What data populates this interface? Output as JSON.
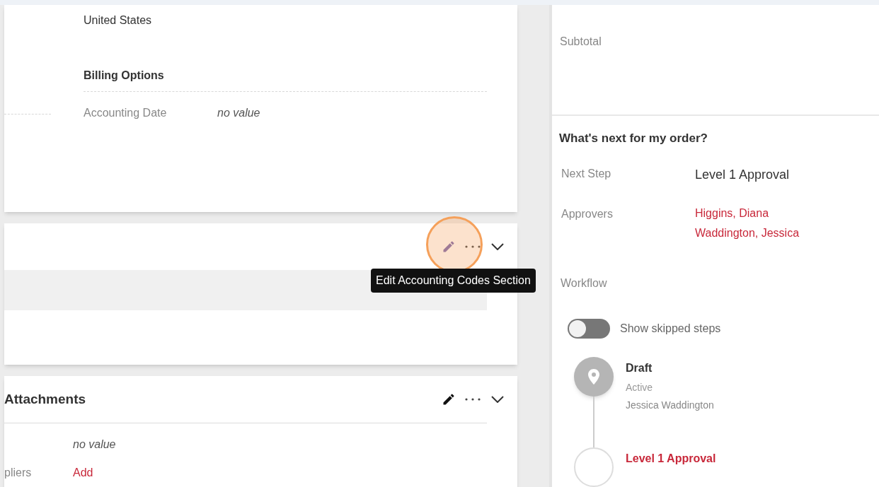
{
  "address": {
    "country": "United States"
  },
  "billing_options": {
    "title": "Billing Options",
    "fields": [
      {
        "label": "Accounting Date",
        "value": "no value"
      }
    ]
  },
  "accounting_codes": {
    "tooltip": "Edit Accounting Codes Section"
  },
  "attachments": {
    "title": "Attachments",
    "fields": [
      {
        "kind": "text",
        "value": "no value"
      },
      {
        "kind": "link",
        "label": "pliers",
        "value": "Add"
      }
    ]
  },
  "summary": {
    "label": "Subtotal"
  },
  "whats_next": {
    "title": "What's next for my order?",
    "next_step": {
      "label": "Next Step",
      "value": "Level 1 Approval"
    },
    "approvers": {
      "label": "Approvers",
      "names": [
        "Higgins, Diana",
        "Waddington, Jessica"
      ]
    }
  },
  "workflow": {
    "label": "Workflow",
    "toggle": {
      "label": "Show skipped steps",
      "on": false
    },
    "steps": [
      {
        "name": "Draft",
        "status": "Active",
        "person": "Jessica Waddington",
        "current": true
      },
      {
        "name": "Level 1 Approval",
        "current": false
      }
    ]
  }
}
